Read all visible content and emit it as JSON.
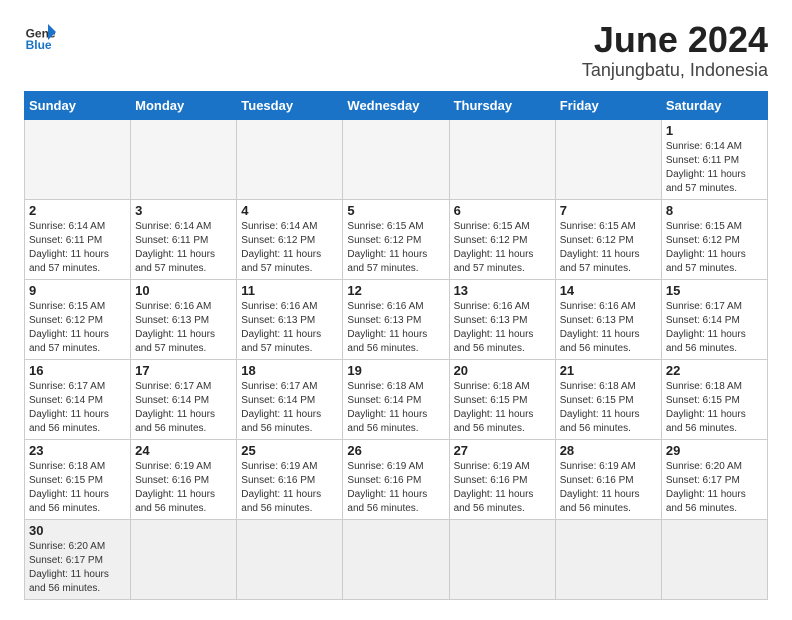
{
  "header": {
    "logo_general": "General",
    "logo_blue": "Blue",
    "title": "June 2024",
    "subtitle": "Tanjungbatu, Indonesia"
  },
  "days_of_week": [
    "Sunday",
    "Monday",
    "Tuesday",
    "Wednesday",
    "Thursday",
    "Friday",
    "Saturday"
  ],
  "weeks": [
    {
      "days": [
        {
          "num": "",
          "info": ""
        },
        {
          "num": "",
          "info": ""
        },
        {
          "num": "",
          "info": ""
        },
        {
          "num": "",
          "info": ""
        },
        {
          "num": "",
          "info": ""
        },
        {
          "num": "",
          "info": ""
        },
        {
          "num": "1",
          "info": "Sunrise: 6:14 AM\nSunset: 6:11 PM\nDaylight: 11 hours\nand 57 minutes."
        }
      ]
    },
    {
      "days": [
        {
          "num": "2",
          "info": "Sunrise: 6:14 AM\nSunset: 6:11 PM\nDaylight: 11 hours\nand 57 minutes."
        },
        {
          "num": "3",
          "info": "Sunrise: 6:14 AM\nSunset: 6:11 PM\nDaylight: 11 hours\nand 57 minutes."
        },
        {
          "num": "4",
          "info": "Sunrise: 6:14 AM\nSunset: 6:12 PM\nDaylight: 11 hours\nand 57 minutes."
        },
        {
          "num": "5",
          "info": "Sunrise: 6:15 AM\nSunset: 6:12 PM\nDaylight: 11 hours\nand 57 minutes."
        },
        {
          "num": "6",
          "info": "Sunrise: 6:15 AM\nSunset: 6:12 PM\nDaylight: 11 hours\nand 57 minutes."
        },
        {
          "num": "7",
          "info": "Sunrise: 6:15 AM\nSunset: 6:12 PM\nDaylight: 11 hours\nand 57 minutes."
        },
        {
          "num": "8",
          "info": "Sunrise: 6:15 AM\nSunset: 6:12 PM\nDaylight: 11 hours\nand 57 minutes."
        }
      ]
    },
    {
      "days": [
        {
          "num": "9",
          "info": "Sunrise: 6:15 AM\nSunset: 6:12 PM\nDaylight: 11 hours\nand 57 minutes."
        },
        {
          "num": "10",
          "info": "Sunrise: 6:16 AM\nSunset: 6:13 PM\nDaylight: 11 hours\nand 57 minutes."
        },
        {
          "num": "11",
          "info": "Sunrise: 6:16 AM\nSunset: 6:13 PM\nDaylight: 11 hours\nand 57 minutes."
        },
        {
          "num": "12",
          "info": "Sunrise: 6:16 AM\nSunset: 6:13 PM\nDaylight: 11 hours\nand 56 minutes."
        },
        {
          "num": "13",
          "info": "Sunrise: 6:16 AM\nSunset: 6:13 PM\nDaylight: 11 hours\nand 56 minutes."
        },
        {
          "num": "14",
          "info": "Sunrise: 6:16 AM\nSunset: 6:13 PM\nDaylight: 11 hours\nand 56 minutes."
        },
        {
          "num": "15",
          "info": "Sunrise: 6:17 AM\nSunset: 6:14 PM\nDaylight: 11 hours\nand 56 minutes."
        }
      ]
    },
    {
      "days": [
        {
          "num": "16",
          "info": "Sunrise: 6:17 AM\nSunset: 6:14 PM\nDaylight: 11 hours\nand 56 minutes."
        },
        {
          "num": "17",
          "info": "Sunrise: 6:17 AM\nSunset: 6:14 PM\nDaylight: 11 hours\nand 56 minutes."
        },
        {
          "num": "18",
          "info": "Sunrise: 6:17 AM\nSunset: 6:14 PM\nDaylight: 11 hours\nand 56 minutes."
        },
        {
          "num": "19",
          "info": "Sunrise: 6:18 AM\nSunset: 6:14 PM\nDaylight: 11 hours\nand 56 minutes."
        },
        {
          "num": "20",
          "info": "Sunrise: 6:18 AM\nSunset: 6:15 PM\nDaylight: 11 hours\nand 56 minutes."
        },
        {
          "num": "21",
          "info": "Sunrise: 6:18 AM\nSunset: 6:15 PM\nDaylight: 11 hours\nand 56 minutes."
        },
        {
          "num": "22",
          "info": "Sunrise: 6:18 AM\nSunset: 6:15 PM\nDaylight: 11 hours\nand 56 minutes."
        }
      ]
    },
    {
      "days": [
        {
          "num": "23",
          "info": "Sunrise: 6:18 AM\nSunset: 6:15 PM\nDaylight: 11 hours\nand 56 minutes."
        },
        {
          "num": "24",
          "info": "Sunrise: 6:19 AM\nSunset: 6:16 PM\nDaylight: 11 hours\nand 56 minutes."
        },
        {
          "num": "25",
          "info": "Sunrise: 6:19 AM\nSunset: 6:16 PM\nDaylight: 11 hours\nand 56 minutes."
        },
        {
          "num": "26",
          "info": "Sunrise: 6:19 AM\nSunset: 6:16 PM\nDaylight: 11 hours\nand 56 minutes."
        },
        {
          "num": "27",
          "info": "Sunrise: 6:19 AM\nSunset: 6:16 PM\nDaylight: 11 hours\nand 56 minutes."
        },
        {
          "num": "28",
          "info": "Sunrise: 6:19 AM\nSunset: 6:16 PM\nDaylight: 11 hours\nand 56 minutes."
        },
        {
          "num": "29",
          "info": "Sunrise: 6:20 AM\nSunset: 6:17 PM\nDaylight: 11 hours\nand 56 minutes."
        }
      ]
    },
    {
      "days": [
        {
          "num": "30",
          "info": "Sunrise: 6:20 AM\nSunset: 6:17 PM\nDaylight: 11 hours\nand 56 minutes."
        },
        {
          "num": "",
          "info": ""
        },
        {
          "num": "",
          "info": ""
        },
        {
          "num": "",
          "info": ""
        },
        {
          "num": "",
          "info": ""
        },
        {
          "num": "",
          "info": ""
        },
        {
          "num": "",
          "info": ""
        }
      ]
    }
  ]
}
